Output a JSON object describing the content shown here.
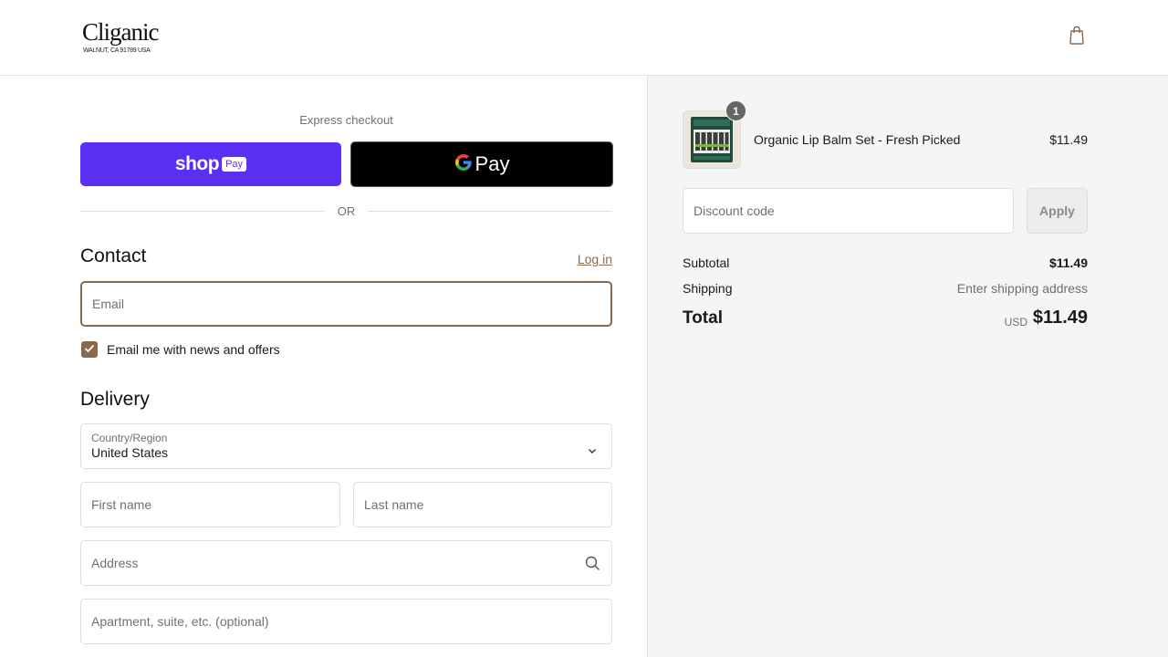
{
  "header": {
    "brand_name": "Cliganic",
    "brand_location": "WALNUT, CA 91789 USA",
    "cart_icon": "shopping-bag-icon"
  },
  "express": {
    "label": "Express checkout",
    "shop_pay_word": "shop",
    "shop_pay_badge": "Pay",
    "google_pay_text": "Pay",
    "or_text": "OR"
  },
  "contact": {
    "title": "Contact",
    "login_link": "Log in",
    "email_placeholder": "Email",
    "newsletter_label": "Email me with news and offers",
    "newsletter_checked": true
  },
  "delivery": {
    "title": "Delivery",
    "country_label": "Country/Region",
    "country_value": "United States",
    "first_name_placeholder": "First name",
    "last_name_placeholder": "Last name",
    "address_placeholder": "Address",
    "apartment_placeholder": "Apartment, suite, etc. (optional)"
  },
  "summary": {
    "item": {
      "quantity": "1",
      "name": "Organic Lip Balm Set - Fresh Picked",
      "price": "$11.49"
    },
    "discount_placeholder": "Discount code",
    "apply_label": "Apply",
    "subtotal_label": "Subtotal",
    "subtotal_value": "$11.49",
    "shipping_label": "Shipping",
    "shipping_value": "Enter shipping address",
    "total_label": "Total",
    "total_currency": "USD",
    "total_value": "$11.49"
  },
  "colors": {
    "accent": "#8a6a4f",
    "shop_pay": "#5a31f4",
    "google_pay": "#000000",
    "summary_bg": "#f5f5f5"
  }
}
